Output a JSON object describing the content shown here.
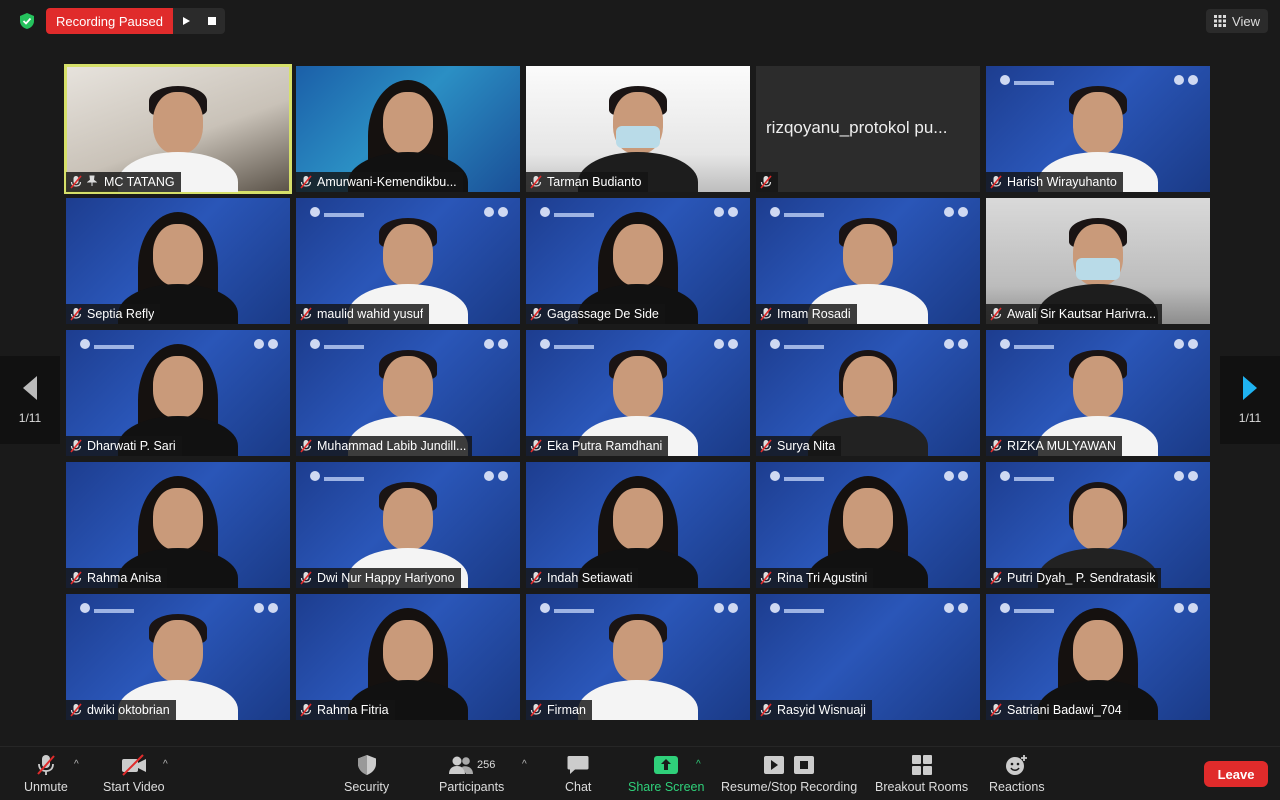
{
  "top_bar": {
    "recording_label": "Recording Paused",
    "view_label": "View"
  },
  "paging": {
    "left_label": "1/11",
    "right_label": "1/11"
  },
  "tiles": [
    {
      "name": "MC TATANG",
      "bg": "cam-room",
      "person": "man",
      "active": true
    },
    {
      "name": "Amurwani-Kemendikbu...",
      "bg": "slide-teal",
      "person": "hijab",
      "slide": false
    },
    {
      "name": "Tarman Budianto",
      "bg": "cam-white",
      "person": "masked"
    },
    {
      "name": "",
      "bg": "blank",
      "display_name": "rizqoyanu_protokol pu..."
    },
    {
      "name": "Harish Wirayuhanto",
      "bg": "slide",
      "person": "man",
      "slide": true
    },
    {
      "name": "Septia Refly",
      "bg": "slide",
      "person": "hijab",
      "slide": false
    },
    {
      "name": "maulid wahid yusuf",
      "bg": "slide",
      "person": "man",
      "slide": true
    },
    {
      "name": "Gagassage De Side",
      "bg": "slide",
      "person": "hijab",
      "slide": true
    },
    {
      "name": "Imam Rosadi",
      "bg": "slide",
      "person": "man",
      "slide": true
    },
    {
      "name": "Awali Sir Kautsar Harivra...",
      "bg": "cam-gray",
      "person": "masked"
    },
    {
      "name": "Dharwati P. Sari",
      "bg": "slide",
      "person": "hijab",
      "slide": true
    },
    {
      "name": "Muhammad Labib Jundill...",
      "bg": "slide",
      "person": "man",
      "slide": true
    },
    {
      "name": "Eka Putra Ramdhani",
      "bg": "slide",
      "person": "man",
      "slide": true
    },
    {
      "name": "Surya Nita",
      "bg": "slide",
      "person": "woman",
      "slide": true
    },
    {
      "name": "RIZKA MULYAWAN",
      "bg": "slide",
      "person": "man",
      "slide": true
    },
    {
      "name": "Rahma Anisa",
      "bg": "slide",
      "person": "hijab",
      "slide": false
    },
    {
      "name": "Dwi Nur Happy Hariyono",
      "bg": "slide",
      "person": "man",
      "slide": true
    },
    {
      "name": "Indah Setiawati",
      "bg": "slide",
      "person": "hijab",
      "slide": false
    },
    {
      "name": "Rina Tri Agustini",
      "bg": "slide",
      "person": "hijab",
      "slide": true
    },
    {
      "name": "Putri Dyah_ P. Sendratasik",
      "bg": "slide",
      "person": "woman",
      "slide": true
    },
    {
      "name": "dwiki oktobrian",
      "bg": "slide",
      "person": "man",
      "slide": true
    },
    {
      "name": "Rahma Fitria",
      "bg": "slide",
      "person": "hijab",
      "slide": false
    },
    {
      "name": "Firman",
      "bg": "slide",
      "person": "man",
      "slide": true
    },
    {
      "name": "Rasyid Wisnuaji",
      "bg": "slide",
      "person": "none",
      "slide": true
    },
    {
      "name": "Satriani Badawi_704",
      "bg": "slide",
      "person": "hijab",
      "slide": true
    }
  ],
  "toolbar": {
    "unmute": "Unmute",
    "start_video": "Start Video",
    "security": "Security",
    "participants": "Participants",
    "participants_count": "256",
    "chat": "Chat",
    "share_screen": "Share Screen",
    "resume_stop_recording": "Resume/Stop Recording",
    "breakout_rooms": "Breakout Rooms",
    "reactions": "Reactions",
    "leave": "Leave"
  },
  "colors": {
    "record_red": "#e02b2b",
    "share_green": "#2fd07a",
    "active_speaker": "#d6e06a"
  }
}
